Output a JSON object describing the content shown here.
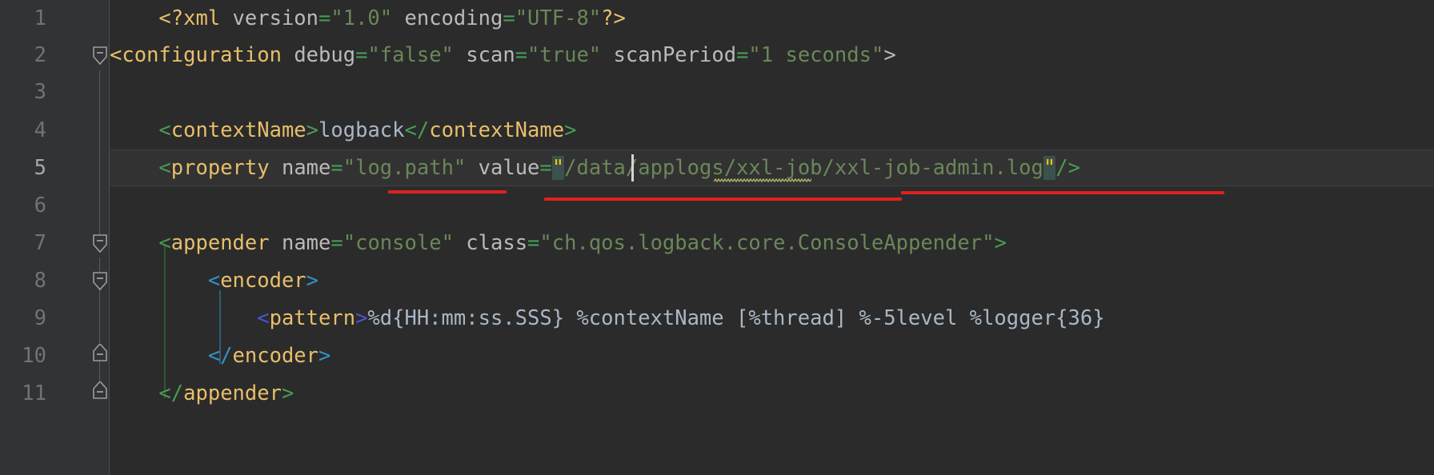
{
  "editor": {
    "background_color": "#2b2b2b",
    "gutter_color": "#313335",
    "current_line_color": "#323232",
    "language": "XML",
    "caret_line": 5,
    "caret_column": 42
  },
  "gutter": {
    "line_numbers": [
      "1",
      "2",
      "3",
      "4",
      "5",
      "6",
      "7",
      "8",
      "9",
      "10",
      "11"
    ],
    "fold_markers": [
      {
        "line": "2",
        "type": "fold-collapse-icon",
        "state": "expanded"
      },
      {
        "line": "7",
        "type": "fold-collapse-icon",
        "state": "expanded"
      },
      {
        "line": "8",
        "type": "fold-collapse-icon",
        "state": "expanded"
      },
      {
        "line": "10",
        "type": "fold-end-icon",
        "state": "expanded"
      },
      {
        "line": "11",
        "type": "fold-end-icon",
        "state": "expanded"
      }
    ]
  },
  "code": {
    "lines": [
      {
        "n": "1",
        "text": "    <?xml version=\"1.0\" encoding=\"UTF-8\"?>",
        "tokens": [
          {
            "t": "    ",
            "c": "plain"
          },
          {
            "t": "<?xml",
            "c": "tag"
          },
          {
            "t": " ",
            "c": "plain"
          },
          {
            "t": "version",
            "c": "attr"
          },
          {
            "t": "=",
            "c": "eq"
          },
          {
            "t": "\"1.0\"",
            "c": "str"
          },
          {
            "t": " ",
            "c": "plain"
          },
          {
            "t": "encoding",
            "c": "attr"
          },
          {
            "t": "=",
            "c": "eq"
          },
          {
            "t": "\"UTF-8\"",
            "c": "str"
          },
          {
            "t": "?>",
            "c": "tag"
          }
        ]
      },
      {
        "n": "2",
        "text": "<configuration debug=\"false\" scan=\"true\" scanPeriod=\"1 seconds\">",
        "tokens": [
          {
            "t": "<",
            "c": "tag"
          },
          {
            "t": "configuration",
            "c": "tag"
          },
          {
            "t": " ",
            "c": "plain"
          },
          {
            "t": "debug",
            "c": "attr"
          },
          {
            "t": "=",
            "c": "eq"
          },
          {
            "t": "\"false\"",
            "c": "str"
          },
          {
            "t": " ",
            "c": "plain"
          },
          {
            "t": "scan",
            "c": "attr"
          },
          {
            "t": "=",
            "c": "eq"
          },
          {
            "t": "\"true\"",
            "c": "str"
          },
          {
            "t": " ",
            "c": "plain"
          },
          {
            "t": "scanPeriod",
            "c": "attr"
          },
          {
            "t": "=",
            "c": "eq"
          },
          {
            "t": "\"1 seconds\"",
            "c": "str"
          },
          {
            "t": ">",
            "c": "attr"
          }
        ]
      },
      {
        "n": "3",
        "text": "",
        "tokens": []
      },
      {
        "n": "4",
        "text": "    <contextName>logback</contextName>",
        "tokens": [
          {
            "t": "    ",
            "c": "plain"
          },
          {
            "t": "<",
            "c": "br-green"
          },
          {
            "t": "contextName",
            "c": "tag"
          },
          {
            "t": ">",
            "c": "br-green"
          },
          {
            "t": "logback",
            "c": "txt"
          },
          {
            "t": "</",
            "c": "br-green"
          },
          {
            "t": "contextName",
            "c": "tag"
          },
          {
            "t": ">",
            "c": "br-green"
          }
        ]
      },
      {
        "n": "5",
        "text": "    <property name=\"log.path\" value=\"/data/applogs/xxl-job/xxl-job-admin.log\"/>",
        "highlighted": true,
        "tokens": [
          {
            "t": "    ",
            "c": "plain"
          },
          {
            "t": "<",
            "c": "br-green"
          },
          {
            "t": "property",
            "c": "tag"
          },
          {
            "t": " ",
            "c": "plain"
          },
          {
            "t": "name",
            "c": "attr"
          },
          {
            "t": "=",
            "c": "eq"
          },
          {
            "t": "\"log.path\"",
            "c": "str"
          },
          {
            "t": " ",
            "c": "plain"
          },
          {
            "t": "value",
            "c": "attr"
          },
          {
            "t": "=",
            "c": "eq"
          },
          {
            "t": "\"",
            "c": "qhl"
          },
          {
            "t": "/data/applogs/xxl-job/xxl-job-admin.log",
            "c": "str"
          },
          {
            "t": "\"",
            "c": "qhl"
          },
          {
            "t": "/>",
            "c": "br-green"
          }
        ]
      },
      {
        "n": "6",
        "text": "",
        "tokens": []
      },
      {
        "n": "7",
        "text": "    <appender name=\"console\" class=\"ch.qos.logback.core.ConsoleAppender\">",
        "tokens": [
          {
            "t": "    ",
            "c": "plain"
          },
          {
            "t": "<",
            "c": "br-green"
          },
          {
            "t": "appender",
            "c": "tag"
          },
          {
            "t": " ",
            "c": "plain"
          },
          {
            "t": "name",
            "c": "attr"
          },
          {
            "t": "=",
            "c": "eq"
          },
          {
            "t": "\"console\"",
            "c": "str"
          },
          {
            "t": " ",
            "c": "plain"
          },
          {
            "t": "class",
            "c": "attr"
          },
          {
            "t": "=",
            "c": "eq"
          },
          {
            "t": "\"ch.qos.logback.core.ConsoleAppender\"",
            "c": "str"
          },
          {
            "t": ">",
            "c": "br-green"
          }
        ]
      },
      {
        "n": "8",
        "text": "        <encoder>",
        "tokens": [
          {
            "t": "        ",
            "c": "plain"
          },
          {
            "t": "<",
            "c": "br-cyan"
          },
          {
            "t": "encoder",
            "c": "tag"
          },
          {
            "t": ">",
            "c": "br-cyan"
          }
        ]
      },
      {
        "n": "9",
        "text": "            <pattern>%d{HH:mm:ss.SSS} %contextName [%thread] %-5level %logger{36}",
        "tokens": [
          {
            "t": "            ",
            "c": "plain"
          },
          {
            "t": "<",
            "c": "br-blue"
          },
          {
            "t": "pattern",
            "c": "tag"
          },
          {
            "t": ">",
            "c": "br-blue"
          },
          {
            "t": "%d{HH:mm:ss.SSS} %contextName [%thread] %-5level %logger{36}",
            "c": "txt"
          }
        ]
      },
      {
        "n": "10",
        "text": "        </encoder>",
        "tokens": [
          {
            "t": "        ",
            "c": "plain"
          },
          {
            "t": "</",
            "c": "br-cyan"
          },
          {
            "t": "encoder",
            "c": "tag"
          },
          {
            "t": ">",
            "c": "br-cyan"
          }
        ]
      },
      {
        "n": "11",
        "text": "    </appender>",
        "tokens": [
          {
            "t": "    ",
            "c": "plain"
          },
          {
            "t": "</",
            "c": "br-green"
          },
          {
            "t": "appender",
            "c": "tag"
          },
          {
            "t": ">",
            "c": "br-green"
          }
        ]
      }
    ]
  },
  "annotations": {
    "color": "#e02020",
    "marks": [
      {
        "name": "underline-log-path-attribute-value",
        "target": "\"log.path\""
      },
      {
        "name": "underline-file-path-value",
        "target": "/data/applogs/xxl-job/xxl-job-admin.log"
      }
    ],
    "spellcheck_squiggle": {
      "word": "applogs",
      "color": "#b5b56a"
    }
  },
  "colors": {
    "tag": "#e8bf6a",
    "attribute": "#bababa",
    "string": "#6a8759",
    "text": "#a9b7c6",
    "bracket_level_1": "#499c54",
    "bracket_level_2": "#3592c4",
    "bracket_level_3": "#4f52d8",
    "line_number": "#707476",
    "caret": "#d4d4d4",
    "quote_match_bg": "#3b514d"
  }
}
